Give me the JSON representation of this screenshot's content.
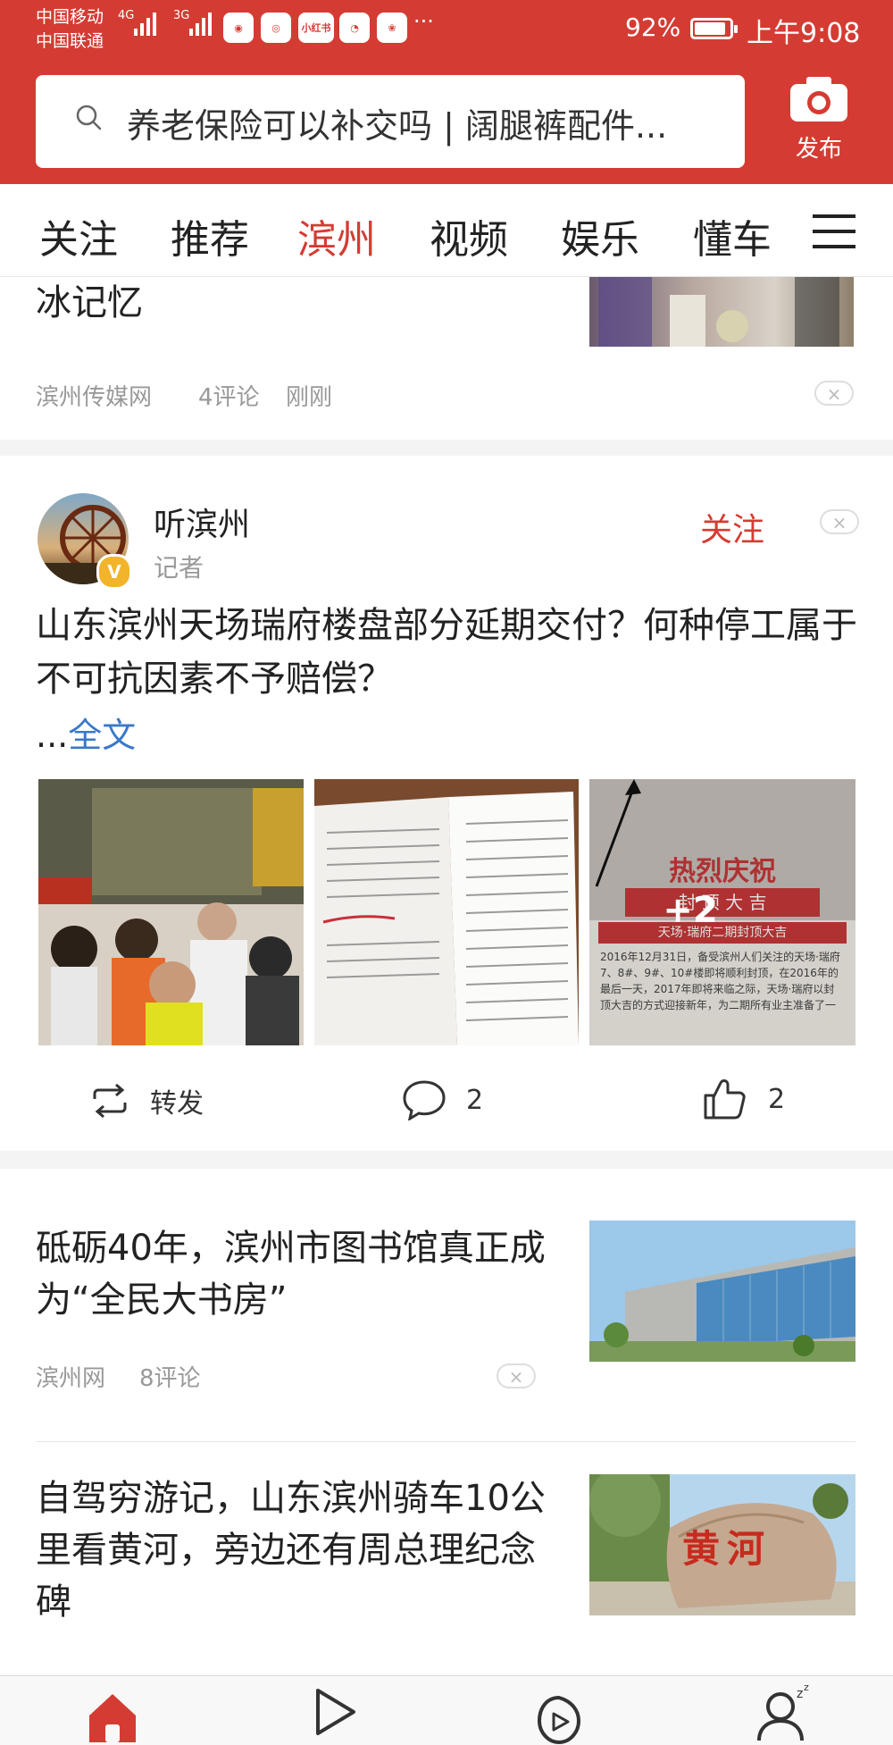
{
  "status_bar": {
    "carrier_1": "中国移动",
    "carrier_2": "中国联通",
    "net_1": "4G",
    "net_2": "3G",
    "app_badge": "小红书",
    "more": "···",
    "battery": "92%",
    "time": "上午9:08"
  },
  "header": {
    "search_placeholder": "养老保险可以补交吗 | 阔腿裤配件...",
    "publish_label": "发布"
  },
  "tabs": [
    "关注",
    "推荐",
    "滨州",
    "视频",
    "娱乐",
    "懂车"
  ],
  "active_tab": 2,
  "article_1": {
    "title_tail": "冰记忆",
    "source": "滨州传媒网",
    "comments": "4评论",
    "time": "刚刚",
    "dismiss": "×"
  },
  "post": {
    "author": "听滨州",
    "role": "记者",
    "verified_badge": "V",
    "follow": "关注",
    "dismiss": "×",
    "text": "山东滨州天场瑞府楼盘部分延期交付？何种停工属于不可抗因素不予赔偿？",
    "ellipsis": "...",
    "full_text": "全文",
    "images": {
      "img3_banner": "热烈庆祝",
      "img3_sub": "封 顶 大 吉",
      "img3_caption": "天场·瑞府二期封顶大吉",
      "img3_body": "2016年12月31日，备受滨州人们关注的天场·瑞府7、8#、9#、10#楼即将顺利封顶，在2016年的最后一天，2017年即将来临之际，天场·瑞府以封顶大吉的方式迎接新年，为二期所有业主准备了一",
      "more_count": "+2"
    },
    "actions": {
      "repost": "转发",
      "comments": "2",
      "likes": "2"
    }
  },
  "article_2": {
    "title": "砥砺40年，滨州市图书馆真正成为“全民大书房”",
    "source": "滨州网",
    "comments": "8评论",
    "dismiss": "×"
  },
  "article_3": {
    "title": "自驾穷游记，山东滨州骑车10公里看黄河，旁边还有周总理纪念碑",
    "stone_text": "黄河"
  },
  "colors": {
    "brand_red": "#d43c33",
    "text": "#222222",
    "meta": "#999999"
  }
}
